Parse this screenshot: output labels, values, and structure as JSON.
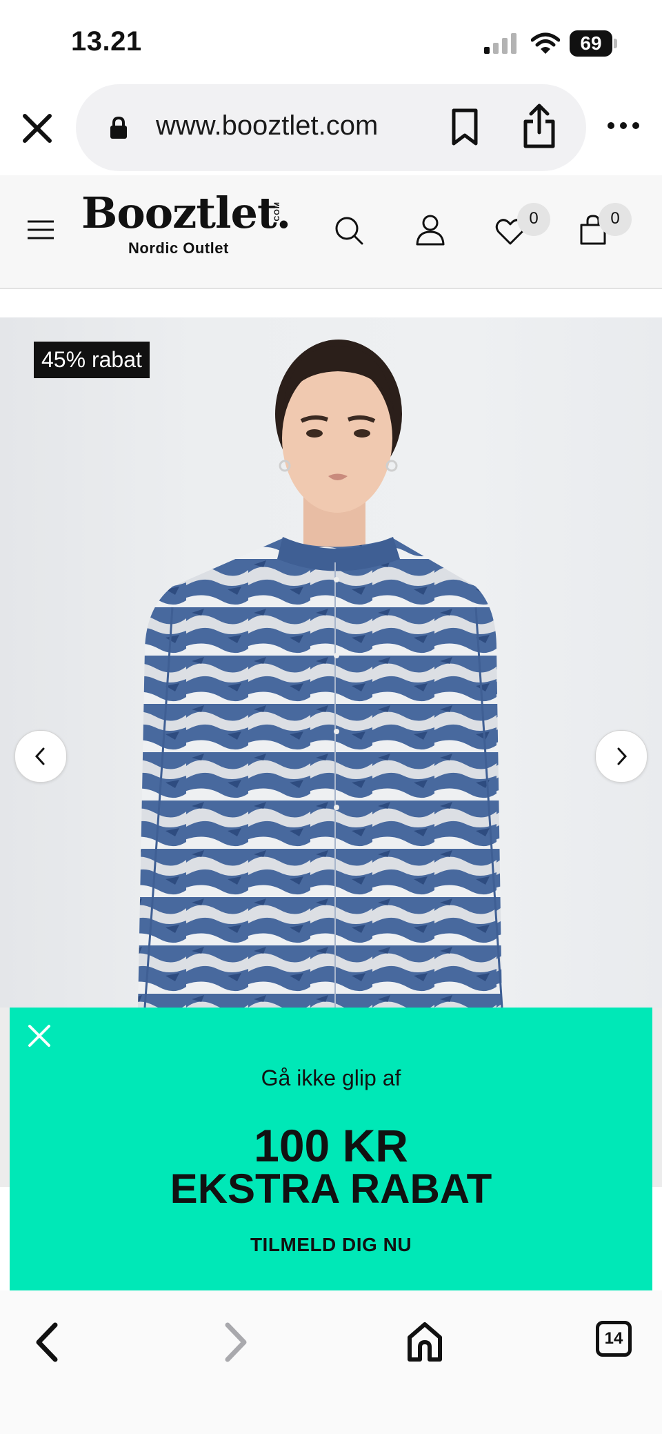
{
  "status_bar": {
    "time": "13.21",
    "battery": "69"
  },
  "browser": {
    "url": "www.booztlet.com",
    "tab_count": "14"
  },
  "site_header": {
    "logo": "Booztlet.",
    "logo_com": "COM",
    "logo_sub": "Nordic Outlet",
    "wishlist_count": "0",
    "cart_count": "0"
  },
  "product": {
    "discount_label": "45% rabat",
    "image_alt": "Blouse with blue and white abstract print"
  },
  "promo": {
    "line1": "Gå ikke glip af",
    "line2": "100 KR",
    "line3": "EKSTRA RABAT",
    "cta": "TILMELD DIG NU",
    "bg_color": "#00e8b7"
  }
}
